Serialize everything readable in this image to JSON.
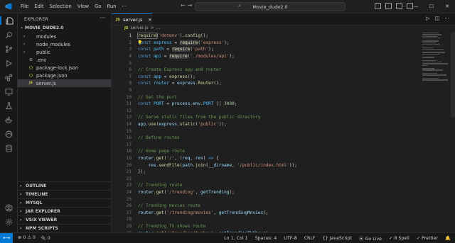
{
  "titlebar": {
    "menus": [
      "File",
      "Edit",
      "Selection",
      "View",
      "Go",
      "Run",
      "···"
    ],
    "search_text": "Movie_dude2.0",
    "nav_back": "←",
    "nav_fwd": "→"
  },
  "activity_bar": {
    "icons": [
      "files-icon",
      "search-icon",
      "source-control-icon",
      "run-debug-icon",
      "extensions-icon",
      "remote-explorer-icon",
      "testing-icon",
      "docker-icon",
      "edge-icon",
      "database-icon",
      "account-icon",
      "settings-icon"
    ]
  },
  "sidebar": {
    "title": "EXPLORER",
    "menu": "···",
    "project": "MOVIE_DUDE2.0",
    "files": [
      {
        "name": "modules",
        "type": "folder",
        "icon": "folder-icon",
        "chev": "›"
      },
      {
        "name": "node_modules",
        "type": "folder",
        "icon": "folder-icon",
        "chev": "›"
      },
      {
        "name": "public",
        "type": "folder",
        "icon": "folder-icon",
        "chev": "›"
      },
      {
        "name": ".env",
        "type": "file",
        "icon": "gear-icon",
        "chev": ""
      },
      {
        "name": "package-lock.json",
        "type": "file",
        "icon": "json-icon",
        "chev": ""
      },
      {
        "name": "package.json",
        "type": "file",
        "icon": "json-icon",
        "chev": ""
      },
      {
        "name": "server.js",
        "type": "file",
        "icon": "js-icon",
        "chev": "",
        "selected": true
      }
    ],
    "sections": [
      "OUTLINE",
      "TIMELINE",
      "MYSQL",
      "JAR EXPLORER",
      "VSIX VIEWER",
      "NPM SCRIPTS"
    ]
  },
  "editor": {
    "tab_label": "server.js",
    "tab_icon_text": "JS",
    "breadcrumb": [
      "server.js",
      ">",
      "..."
    ],
    "lines": [
      {
        "n": "1",
        "html": [
          [
            "fn sel-box",
            "require"
          ],
          [
            "txt",
            "("
          ],
          [
            "str",
            "'dotenv'"
          ],
          [
            "txt",
            ")."
          ],
          [
            "fn",
            "config"
          ],
          [
            "txt",
            "();"
          ]
        ]
      },
      {
        "n": "2",
        "html": [
          [
            "kw",
            "const"
          ],
          [
            "txt",
            " "
          ],
          [
            "const",
            "express"
          ],
          [
            "txt",
            " = "
          ],
          [
            "fn hl",
            "require"
          ],
          [
            "txt",
            "("
          ],
          [
            "str",
            "'express'"
          ],
          [
            "txt",
            ");"
          ]
        ]
      },
      {
        "n": "3",
        "html": [
          [
            "kw",
            "const"
          ],
          [
            "txt",
            " "
          ],
          [
            "const",
            "path"
          ],
          [
            "txt",
            " = "
          ],
          [
            "fn hl",
            "require"
          ],
          [
            "txt",
            "("
          ],
          [
            "str",
            "'path'"
          ],
          [
            "txt",
            ");"
          ]
        ]
      },
      {
        "n": "4",
        "html": [
          [
            "kw",
            "const"
          ],
          [
            "txt",
            " "
          ],
          [
            "const",
            "api"
          ],
          [
            "txt",
            " = "
          ],
          [
            "fn hl",
            "require"
          ],
          [
            "txt",
            "("
          ],
          [
            "str",
            "'./modules/api'"
          ],
          [
            "txt",
            ");"
          ]
        ]
      },
      {
        "n": "5",
        "html": []
      },
      {
        "n": "6",
        "html": [
          [
            "cm",
            "// Create Express app and router"
          ]
        ]
      },
      {
        "n": "7",
        "html": [
          [
            "kw",
            "const"
          ],
          [
            "txt",
            " "
          ],
          [
            "const",
            "app"
          ],
          [
            "txt",
            " = "
          ],
          [
            "fn",
            "express"
          ],
          [
            "txt",
            "();"
          ]
        ]
      },
      {
        "n": "8",
        "html": [
          [
            "kw",
            "const"
          ],
          [
            "txt",
            " "
          ],
          [
            "const",
            "router"
          ],
          [
            "txt",
            " = "
          ],
          [
            "var",
            "express"
          ],
          [
            "txt",
            "."
          ],
          [
            "fn",
            "Router"
          ],
          [
            "txt",
            "();"
          ]
        ]
      },
      {
        "n": "9",
        "html": []
      },
      {
        "n": "10",
        "html": [
          [
            "cm",
            "// Set the port"
          ]
        ]
      },
      {
        "n": "11",
        "html": [
          [
            "kw",
            "const"
          ],
          [
            "txt",
            " "
          ],
          [
            "const",
            "PORT"
          ],
          [
            "txt",
            " = "
          ],
          [
            "var",
            "process"
          ],
          [
            "txt",
            "."
          ],
          [
            "var",
            "env"
          ],
          [
            "txt",
            "."
          ],
          [
            "const",
            "PORT"
          ],
          [
            "txt",
            " || "
          ],
          [
            "num",
            "3000"
          ],
          [
            "txt",
            ";"
          ]
        ]
      },
      {
        "n": "12",
        "html": []
      },
      {
        "n": "13",
        "html": [
          [
            "cm",
            "// Serve static files from the public directory"
          ]
        ]
      },
      {
        "n": "14",
        "html": [
          [
            "var",
            "app"
          ],
          [
            "txt",
            "."
          ],
          [
            "fn",
            "use"
          ],
          [
            "txt",
            "("
          ],
          [
            "var",
            "express"
          ],
          [
            "txt",
            "."
          ],
          [
            "fn",
            "static"
          ],
          [
            "txt",
            "("
          ],
          [
            "str",
            "'public'"
          ],
          [
            "txt",
            "));"
          ]
        ]
      },
      {
        "n": "15",
        "html": []
      },
      {
        "n": "16",
        "html": [
          [
            "cm",
            "// Define routes"
          ]
        ]
      },
      {
        "n": "17",
        "html": []
      },
      {
        "n": "18",
        "html": [
          [
            "cm",
            "// Home page route"
          ]
        ]
      },
      {
        "n": "19",
        "html": [
          [
            "var",
            "router"
          ],
          [
            "txt",
            "."
          ],
          [
            "fn",
            "get"
          ],
          [
            "txt",
            "("
          ],
          [
            "str",
            "'/'"
          ],
          [
            "txt",
            ", ("
          ],
          [
            "var",
            "req"
          ],
          [
            "txt",
            ", "
          ],
          [
            "var",
            "res"
          ],
          [
            "txt",
            ") "
          ],
          [
            "kw",
            "=>"
          ],
          [
            "txt",
            " {"
          ]
        ]
      },
      {
        "n": "20",
        "html": [
          [
            "txt",
            "    "
          ],
          [
            "var",
            "res"
          ],
          [
            "txt",
            "."
          ],
          [
            "fn",
            "sendFile"
          ],
          [
            "txt",
            "("
          ],
          [
            "var",
            "path"
          ],
          [
            "txt",
            "."
          ],
          [
            "fn",
            "join"
          ],
          [
            "txt",
            "("
          ],
          [
            "var",
            "__dirname"
          ],
          [
            "txt",
            ", "
          ],
          [
            "str",
            "'/public/index.html'"
          ],
          [
            "txt",
            "));"
          ]
        ]
      },
      {
        "n": "21",
        "html": [
          [
            "txt",
            "});"
          ]
        ]
      },
      {
        "n": "22",
        "html": []
      },
      {
        "n": "23",
        "html": [
          [
            "cm",
            "// Trending route"
          ]
        ]
      },
      {
        "n": "24",
        "html": [
          [
            "var",
            "router"
          ],
          [
            "txt",
            "."
          ],
          [
            "fn",
            "get"
          ],
          [
            "txt",
            "("
          ],
          [
            "str",
            "'/trending'"
          ],
          [
            "txt",
            ", "
          ],
          [
            "var",
            "getTrending"
          ],
          [
            "txt",
            ");"
          ]
        ]
      },
      {
        "n": "25",
        "html": []
      },
      {
        "n": "26",
        "html": [
          [
            "cm",
            "// Trending movies route"
          ]
        ]
      },
      {
        "n": "27",
        "html": [
          [
            "var",
            "router"
          ],
          [
            "txt",
            "."
          ],
          [
            "fn",
            "get"
          ],
          [
            "txt",
            "("
          ],
          [
            "str",
            "'/trending/movies'"
          ],
          [
            "txt",
            ", "
          ],
          [
            "var",
            "getTrendingMovies"
          ],
          [
            "txt",
            ");"
          ]
        ]
      },
      {
        "n": "28",
        "html": []
      },
      {
        "n": "29",
        "html": [
          [
            "cm",
            "// Trending TV shows route"
          ]
        ]
      },
      {
        "n": "30",
        "html": [
          [
            "var",
            "router"
          ],
          [
            "txt",
            "."
          ],
          [
            "fn",
            "get"
          ],
          [
            "txt",
            "("
          ],
          [
            "str",
            "'/trending/tvshow'"
          ],
          [
            "txt",
            ", "
          ],
          [
            "var",
            "getTrendingTVShows"
          ],
          [
            "txt",
            ");"
          ]
        ]
      }
    ]
  },
  "statusbar": {
    "left": [
      "⊗ 0 ⚠ 0",
      "🔌 0"
    ],
    "right": [
      "Ln 1, Col 1",
      "Spaces: 4",
      "UTF-8",
      "CRLF",
      "{} JavaScript",
      "⦿ Go Live",
      "✓ 8 Spell",
      "✓ Prettier",
      "🔔"
    ]
  },
  "colors": {
    "accent": "#0078d4",
    "bg": "#1f1f1f",
    "sidebar": "#181818"
  }
}
